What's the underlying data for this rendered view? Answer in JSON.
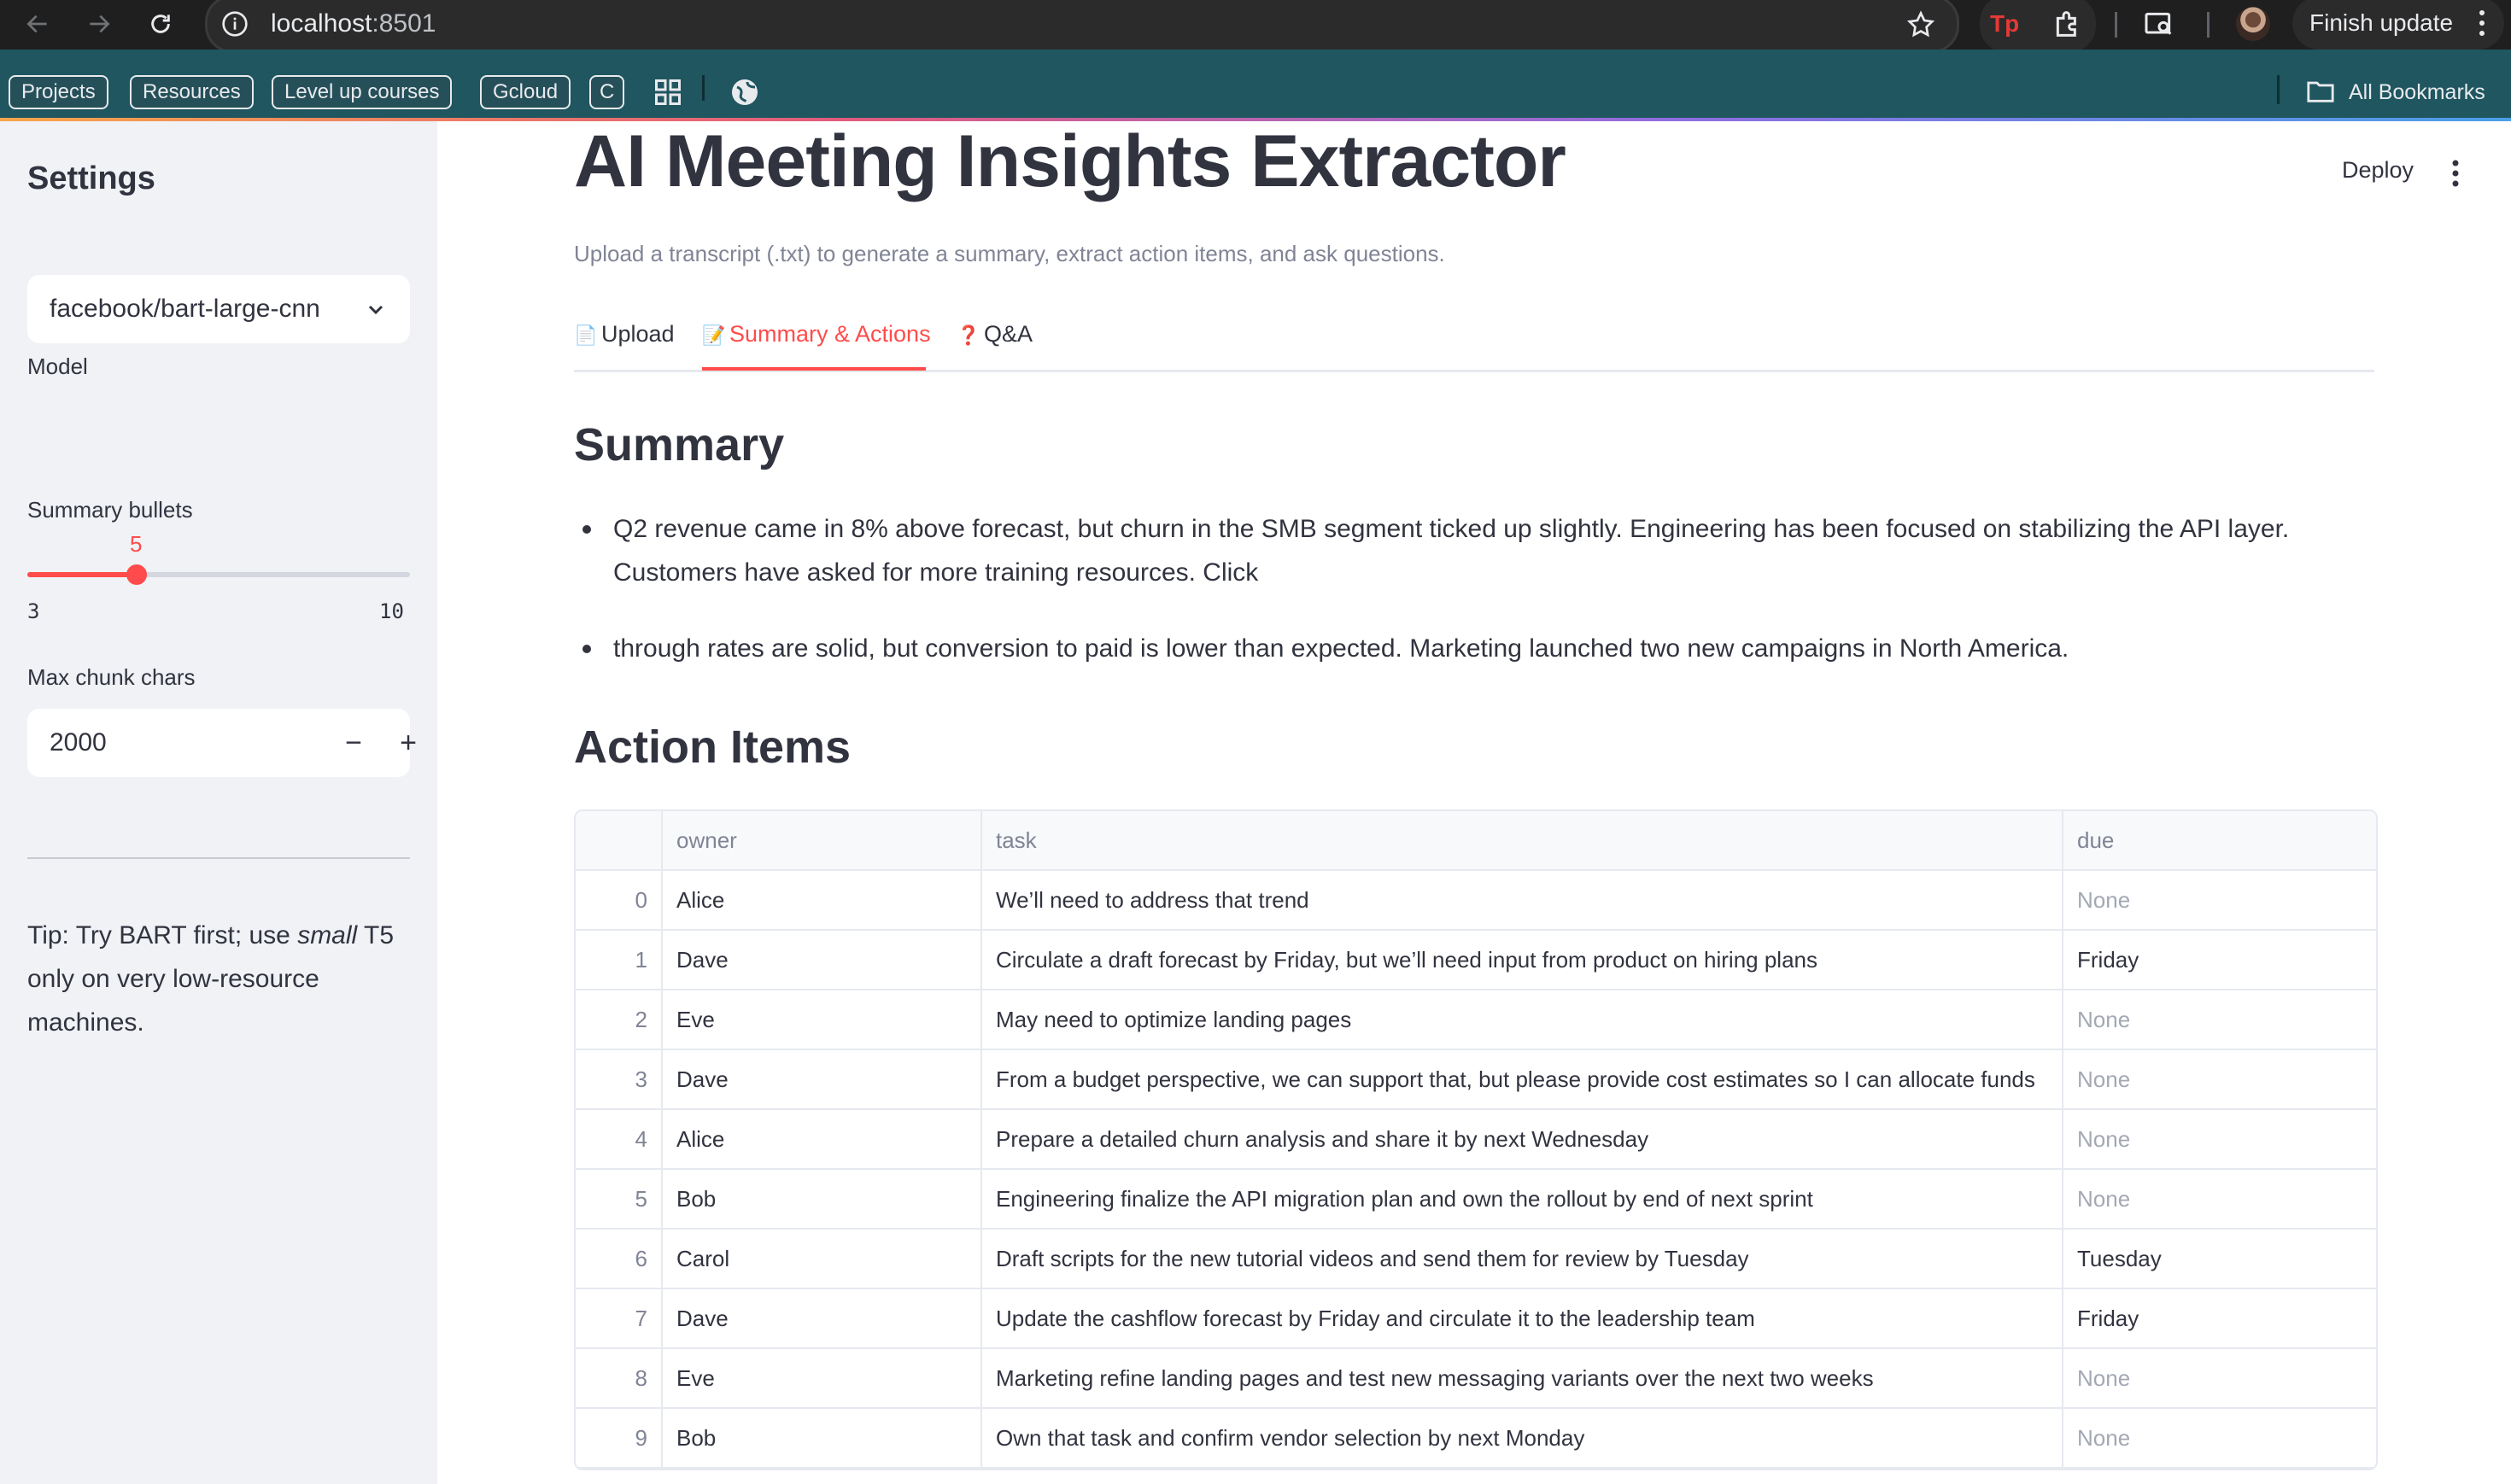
{
  "browser": {
    "url_host": "localhost",
    "url_port": ":8501",
    "finish_update_label": "Finish update",
    "extension_tp_label": "Tp",
    "bookmarks": [
      "Projects",
      "Resources",
      "Level up courses",
      "Gcloud",
      "C"
    ],
    "all_bookmarks_label": "All Bookmarks"
  },
  "sidebar": {
    "title": "Settings",
    "model_label": "Model",
    "model_value": "facebook/bart-large-cnn",
    "bullets_label": "Summary bullets",
    "bullets_value": "5",
    "bullets_value_num": 5,
    "bullets_min": "3",
    "bullets_max": "10",
    "chunk_label": "Max chunk chars",
    "chunk_value": "2000",
    "tip_prefix": "Tip: Try BART first; use ",
    "tip_em": "small",
    "tip_suffix": " T5 only on very low-resource machines."
  },
  "header": {
    "deploy_label": "Deploy"
  },
  "main": {
    "title": "AI Meeting Insights Extractor",
    "caption": "Upload a transcript (.txt) to generate a summary, extract action items, and ask questions.",
    "tabs": [
      {
        "icon": "📄",
        "label": "Upload"
      },
      {
        "icon": "📝",
        "label": "Summary & Actions"
      },
      {
        "icon": "❓",
        "label": "Q&A"
      }
    ],
    "summary_heading": "Summary",
    "summary_bullets": [
      "Q2 revenue came in 8% above forecast, but churn in the SMB segment ticked up slightly. Engineering has been focused on stabilizing the API layer. Customers have asked for more training resources. Click",
      "through rates are solid, but conversion to paid is lower than expected. Marketing launched two new campaigns in North America."
    ],
    "actions_heading": "Action Items",
    "table_headers": [
      "",
      "owner",
      "task",
      "due"
    ],
    "table_rows": [
      {
        "idx": "0",
        "owner": "Alice",
        "task": "We’ll need to address that trend",
        "due": "None"
      },
      {
        "idx": "1",
        "owner": "Dave",
        "task": "Circulate a draft forecast by Friday, but we’ll need input from product on hiring plans",
        "due": "Friday"
      },
      {
        "idx": "2",
        "owner": "Eve",
        "task": "May need to optimize landing pages",
        "due": "None"
      },
      {
        "idx": "3",
        "owner": "Dave",
        "task": "From a budget perspective, we can support that, but please provide cost estimates so I can allocate funds",
        "due": "None"
      },
      {
        "idx": "4",
        "owner": "Alice",
        "task": "Prepare a detailed churn analysis and share it by next Wednesday",
        "due": "None"
      },
      {
        "idx": "5",
        "owner": "Bob",
        "task": "Engineering finalize the API migration plan and own the rollout by end of next sprint",
        "due": "None"
      },
      {
        "idx": "6",
        "owner": "Carol",
        "task": "Draft scripts for the new tutorial videos and send them for review by Tuesday",
        "due": "Tuesday"
      },
      {
        "idx": "7",
        "owner": "Dave",
        "task": "Update the cashflow forecast by Friday and circulate it to the leadership team",
        "due": "Friday"
      },
      {
        "idx": "8",
        "owner": "Eve",
        "task": "Marketing refine landing pages and test new messaging variants over the next two weeks",
        "due": "None"
      },
      {
        "idx": "9",
        "owner": "Bob",
        "task": "Own that task and confirm vendor selection by next Monday",
        "due": "None"
      }
    ]
  },
  "colors": {
    "accent": "#ff4b4b",
    "sidebar_bg": "#f0f2f6",
    "bookmarks_bg": "#1f5660",
    "chrome_bg": "#1f1f1f"
  }
}
